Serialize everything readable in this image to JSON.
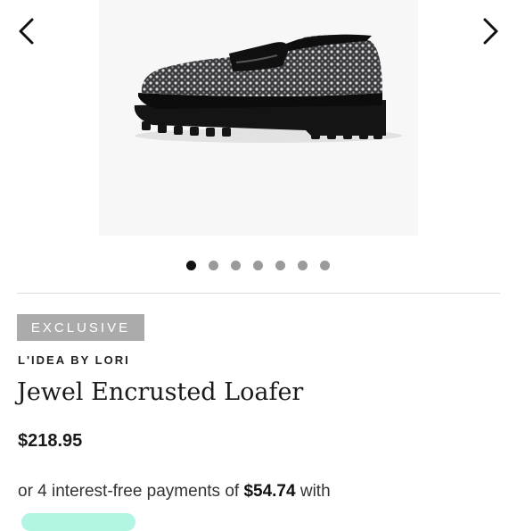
{
  "gallery": {
    "prev_icon": "chevron-left-icon",
    "next_icon": "chevron-right-icon",
    "image_alt": "Jewel Encrusted Loafer product photo",
    "slide_count": 7,
    "active_slide": 1
  },
  "badge": {
    "label": "EXCLUSIVE",
    "color": "#ababab"
  },
  "product": {
    "brand": "L'IDEA BY LORI",
    "title": "Jewel Encrusted Loafer",
    "price": "$218.95"
  },
  "installments": {
    "prefix": "or 4 interest-free payments of ",
    "amount": "$54.74",
    "suffix": " with"
  },
  "pay_pill": {
    "color": "#b3f5e3"
  }
}
